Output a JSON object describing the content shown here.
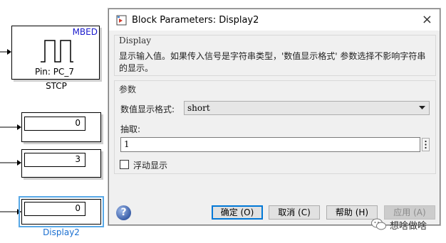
{
  "canvas": {
    "stcp_block": {
      "tag": "MBED",
      "pin": "Pin: PC_7",
      "caption": "STCP"
    },
    "displays": [
      {
        "value": "0"
      },
      {
        "value": "3"
      },
      {
        "value": "0",
        "caption": "Display2",
        "selected": true
      }
    ]
  },
  "dialog": {
    "title": "Block Parameters: Display2",
    "close_symbol": "×",
    "display_group": {
      "title": "Display",
      "description": "显示输入值。如果传入信号是字符串类型，'数值显示格式' 参数选择不影响字符串的显示。"
    },
    "params_group": {
      "title": "参数",
      "format_label": "数值显示格式:",
      "format_value": "short",
      "decimation_label": "抽取:",
      "decimation_value": "1",
      "floating_label": "浮动显示",
      "floating_checked": false
    },
    "buttons": {
      "ok": "确定 (O)",
      "cancel": "取消 (C)",
      "help": "帮助 (H)",
      "apply": "应用 (A)"
    },
    "help_icon": "?"
  },
  "watermark": {
    "text": "想啥做啥",
    "icon": "wechat-icon"
  },
  "colors": {
    "accent": "#0078d7",
    "selection": "#58a8e6",
    "mbed_text": "#1a1acc",
    "caption_blue": "#1a6fd1"
  }
}
